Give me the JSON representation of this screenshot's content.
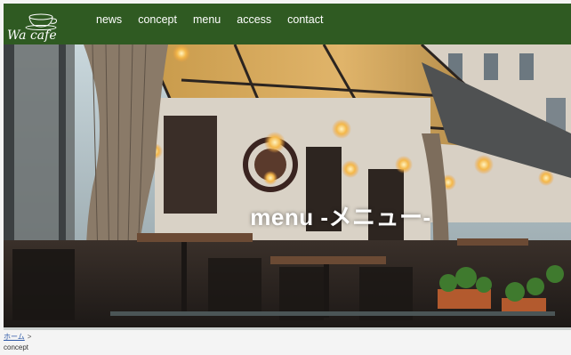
{
  "header": {
    "logo_text": "Wa cafe",
    "nav": [
      {
        "label": "news"
      },
      {
        "label": "concept"
      },
      {
        "label": "menu"
      },
      {
        "label": "access"
      },
      {
        "label": "contact"
      }
    ],
    "bg_color": "#2f5a22"
  },
  "hero": {
    "title": "menu -メニュー-"
  },
  "breadcrumb": {
    "home_label": "ホーム",
    "separator": ">",
    "current": "concept"
  }
}
